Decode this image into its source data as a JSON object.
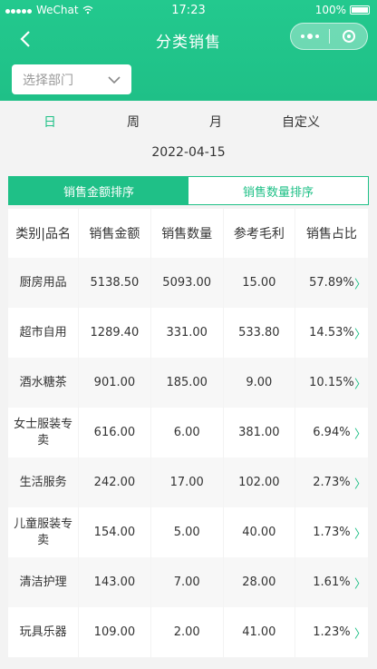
{
  "status": {
    "carrier": "WeChat",
    "time": "17:23",
    "battery": "100%"
  },
  "nav": {
    "title": "分类销售"
  },
  "dept": {
    "placeholder": "选择部门"
  },
  "periods": [
    "日",
    "周",
    "月",
    "自定义"
  ],
  "date": "2022-04-15",
  "tabs": {
    "amount": "销售金额排序",
    "quantity": "销售数量排序"
  },
  "table": {
    "headers": [
      "类别|品名",
      "销售金额",
      "销售数量",
      "参考毛利",
      "销售占比"
    ],
    "rows": [
      {
        "name": "厨房用品",
        "amount": "5138.50",
        "qty": "5093.00",
        "profit": "15.00",
        "share": "57.89%"
      },
      {
        "name": "超市自用",
        "amount": "1289.40",
        "qty": "331.00",
        "profit": "533.80",
        "share": "14.53%"
      },
      {
        "name": "酒水糖茶",
        "amount": "901.00",
        "qty": "185.00",
        "profit": "9.00",
        "share": "10.15%"
      },
      {
        "name": "女士服装专卖",
        "amount": "616.00",
        "qty": "6.00",
        "profit": "381.00",
        "share": "6.94%"
      },
      {
        "name": "生活服务",
        "amount": "242.00",
        "qty": "17.00",
        "profit": "102.00",
        "share": "2.73%"
      },
      {
        "name": "儿童服装专卖",
        "amount": "154.00",
        "qty": "5.00",
        "profit": "40.00",
        "share": "1.73%"
      },
      {
        "name": "清洁护理",
        "amount": "143.00",
        "qty": "7.00",
        "profit": "28.00",
        "share": "1.61%"
      },
      {
        "name": "玩具乐器",
        "amount": "109.00",
        "qty": "2.00",
        "profit": "41.00",
        "share": "1.23%"
      }
    ]
  },
  "colors": {
    "accent": "#1fc087"
  },
  "icons": {
    "back": "back-arrow-icon",
    "more": "more-dots-icon",
    "close": "close-circle-icon",
    "chevron": "chevron-down-icon",
    "row_arrow": "chevron-right-icon"
  }
}
